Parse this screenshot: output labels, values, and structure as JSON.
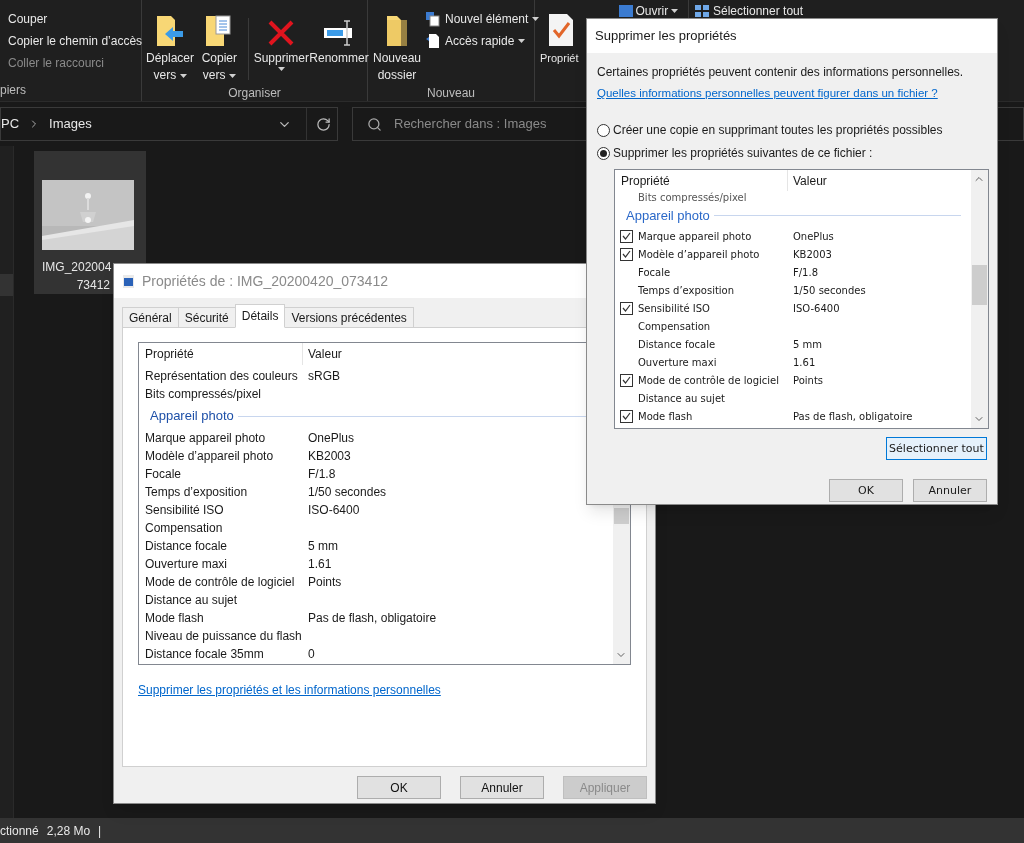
{
  "ribbon": {
    "clipboard": {
      "label": "piers",
      "items": [
        {
          "label": "Couper",
          "disabled": false
        },
        {
          "label": "Copier le chemin d’accès",
          "disabled": false
        },
        {
          "label": "Coller le raccourci",
          "disabled": true
        }
      ]
    },
    "organiser": {
      "label": "Organiser",
      "buttons": [
        {
          "label": "Déplacer vers",
          "dropdown": true
        },
        {
          "label": "Copier vers",
          "dropdown": true
        },
        {
          "label": "Supprimer",
          "dropdown": true
        },
        {
          "label": "Renommer",
          "dropdown": false
        }
      ]
    },
    "nouveau": {
      "label": "Nouveau",
      "big": {
        "label": "Nouveau dossier"
      },
      "small": [
        {
          "label": "Nouvel élément",
          "dropdown": true
        },
        {
          "label": "Accès rapide",
          "dropdown": true
        }
      ]
    },
    "ouvrir": {
      "big": {
        "label": "Propriét"
      },
      "small": [
        {
          "label": "Ouvrir",
          "dropdown": true
        }
      ]
    },
    "selection": {
      "small": [
        {
          "label": "Sélectionner tout"
        }
      ]
    }
  },
  "address": {
    "path": [
      "PC",
      "Images"
    ],
    "search_placeholder": "Rechercher dans : Images"
  },
  "files": [
    {
      "name_lines": [
        "IMG_202004",
        "73412"
      ],
      "selected": true
    }
  ],
  "status_bar": [
    "ctionné",
    "2,28 Mo",
    "|"
  ],
  "properties_dialog": {
    "title": "Propriétés de : IMG_20200420_073412",
    "tabs": [
      {
        "label": "Général",
        "selected": false
      },
      {
        "label": "Sécurité",
        "selected": false
      },
      {
        "label": "Détails",
        "selected": true
      },
      {
        "label": "Versions précédentes",
        "selected": false
      }
    ],
    "columns": [
      "Propriété",
      "Valeur"
    ],
    "rows": [
      {
        "kind": "row",
        "property": "Représentation des couleurs",
        "value": "sRGB"
      },
      {
        "kind": "row",
        "property": "Bits compressés/pixel"
      },
      {
        "kind": "group",
        "label": "Appareil photo"
      },
      {
        "kind": "row",
        "property": "Marque appareil photo",
        "value": "OnePlus"
      },
      {
        "kind": "row",
        "property": "Modèle d’appareil photo",
        "value": "KB2003"
      },
      {
        "kind": "row",
        "property": "Focale",
        "value": "F/1.8"
      },
      {
        "kind": "row",
        "property": "Temps d’exposition",
        "value": "1/50 secondes"
      },
      {
        "kind": "row",
        "property": "Sensibilité ISO",
        "value": "ISO-6400"
      },
      {
        "kind": "row",
        "property": "Compensation"
      },
      {
        "kind": "row",
        "property": "Distance focale",
        "value": "5 mm"
      },
      {
        "kind": "row",
        "property": "Ouverture maxi",
        "value": "1.61"
      },
      {
        "kind": "row",
        "property": "Mode de contrôle de logiciel",
        "value": "Points"
      },
      {
        "kind": "row",
        "property": "Distance au sujet"
      },
      {
        "kind": "row",
        "property": "Mode flash",
        "value": "Pas de flash, obligatoire"
      },
      {
        "kind": "row",
        "property": "Niveau de puissance du flash"
      },
      {
        "kind": "row",
        "property": "Distance focale 35mm",
        "value": "0"
      }
    ],
    "link": "Supprimer les propriétés et les informations personnelles",
    "buttons": [
      {
        "label": "OK",
        "disabled": false
      },
      {
        "label": "Annuler",
        "disabled": false
      },
      {
        "label": "Appliquer",
        "disabled": true
      }
    ]
  },
  "remove_dialog": {
    "title": "Supprimer les propriétés",
    "intro": "Certaines propriétés peuvent contenir des informations personnelles.",
    "link": "Quelles informations personnelles peuvent figurer dans un fichier ?",
    "options": [
      {
        "label": "Créer une copie en supprimant toutes les propriétés possibles",
        "selected": false
      },
      {
        "label": "Supprimer les propriétés suivantes de ce fichier :",
        "selected": true
      }
    ],
    "columns": [
      "Propriété",
      "Valeur"
    ],
    "rows": [
      {
        "kind": "partial",
        "property": "Bits compressés/pixel"
      },
      {
        "kind": "group",
        "label": "Appareil photo"
      },
      {
        "kind": "checkbox",
        "checked": true,
        "property": "Marque appareil photo",
        "value": "OnePlus"
      },
      {
        "kind": "checkbox",
        "checked": true,
        "property": "Modèle d’appareil photo",
        "value": "KB2003"
      },
      {
        "kind": "plain",
        "property": "Focale",
        "value": "F/1.8"
      },
      {
        "kind": "plain",
        "property": "Temps d’exposition",
        "value": "1/50 secondes"
      },
      {
        "kind": "checkbox",
        "checked": true,
        "property": "Sensibilité ISO",
        "value": "ISO-6400"
      },
      {
        "kind": "plain",
        "property": "Compensation"
      },
      {
        "kind": "plain",
        "property": "Distance focale",
        "value": "5 mm"
      },
      {
        "kind": "plain",
        "property": "Ouverture maxi",
        "value": "1.61"
      },
      {
        "kind": "checkbox",
        "checked": true,
        "property": "Mode de contrôle de logiciel",
        "value": "Points"
      },
      {
        "kind": "plain",
        "property": "Distance au sujet"
      },
      {
        "kind": "checkbox",
        "checked": true,
        "property": "Mode flash",
        "value": "Pas de flash, obligatoire"
      }
    ],
    "select_all": "Sélectionner tout",
    "buttons": [
      {
        "label": "OK"
      },
      {
        "label": "Annuler"
      }
    ]
  }
}
